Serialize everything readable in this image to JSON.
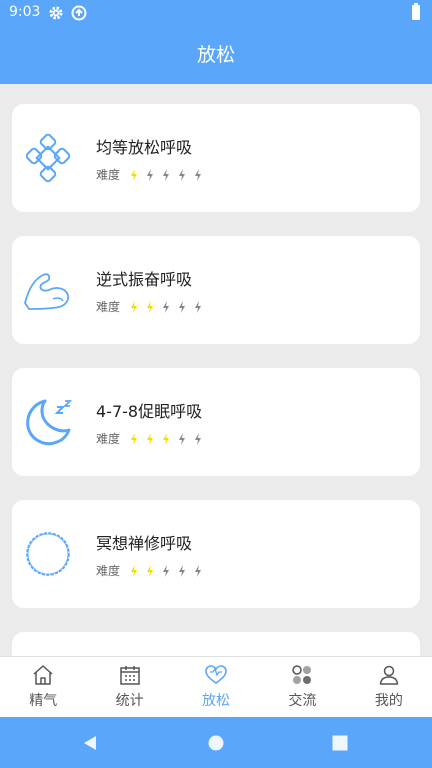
{
  "status_bar": {
    "time": "9:03"
  },
  "app_bar": {
    "title": "放松"
  },
  "cards": [
    {
      "name": "均等放松呼吸",
      "difficulty_label": "难度",
      "difficulty_level": 1,
      "icon": "knot-pattern-icon"
    },
    {
      "name": "逆式振奋呼吸",
      "difficulty_label": "难度",
      "difficulty_level": 2,
      "icon": "flexed-arm-icon"
    },
    {
      "name": "4-7-8促眠呼吸",
      "difficulty_label": "难度",
      "difficulty_level": 3,
      "icon": "moon-sleep-icon"
    },
    {
      "name": "冥想禅修呼吸",
      "difficulty_label": "难度",
      "difficulty_level": 2,
      "icon": "circle-wave-icon"
    }
  ],
  "difficulty_max": 5,
  "bottom_nav": [
    {
      "label": "精气",
      "icon": "home-icon",
      "active": false
    },
    {
      "label": "统计",
      "icon": "calendar-icon",
      "active": false
    },
    {
      "label": "放松",
      "icon": "heart-icon",
      "active": true
    },
    {
      "label": "交流",
      "icon": "community-icon",
      "active": false
    },
    {
      "label": "我的",
      "icon": "person-icon",
      "active": false
    }
  ],
  "colors": {
    "primary": "#5aa6fb",
    "bolt_active": "#f5d90a",
    "bolt_inactive": "#888888",
    "background": "#ebebeb"
  }
}
